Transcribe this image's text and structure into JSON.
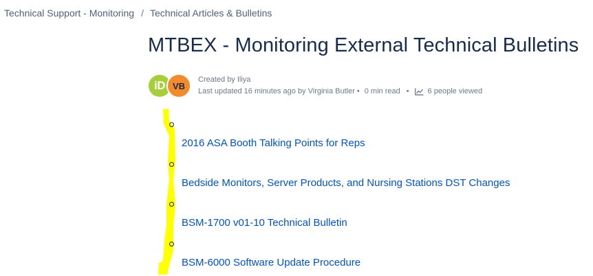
{
  "breadcrumb": {
    "items": [
      "Technical Support - Monitoring",
      "Technical Articles & Bulletins"
    ],
    "separator": "/"
  },
  "page": {
    "title": "MTBEX - Monitoring External Technical Bulletins"
  },
  "meta": {
    "avatars": [
      {
        "initials": "iD",
        "color": "#a6ce39"
      },
      {
        "initials": "VB",
        "color": "#f38a2c"
      }
    ],
    "created_by": "Created by Iliya",
    "last_updated": "Last updated 16 minutes ago by Virginia Butler",
    "dot": "•",
    "read_time": "0 min read",
    "views": "6 people viewed",
    "views_icon": "analytics-chart-icon"
  },
  "links": [
    "2016 ASA Booth Talking Points for Reps",
    "Bedside Monitors, Server Products, and Nursing Stations DST Changes",
    "BSM-1700 v01-10 Technical Bulletin",
    "BSM-6000 Software Update Procedure"
  ],
  "colors": {
    "link": "#0052cc",
    "title": "#172b4d",
    "highlight": "#ffff00"
  }
}
